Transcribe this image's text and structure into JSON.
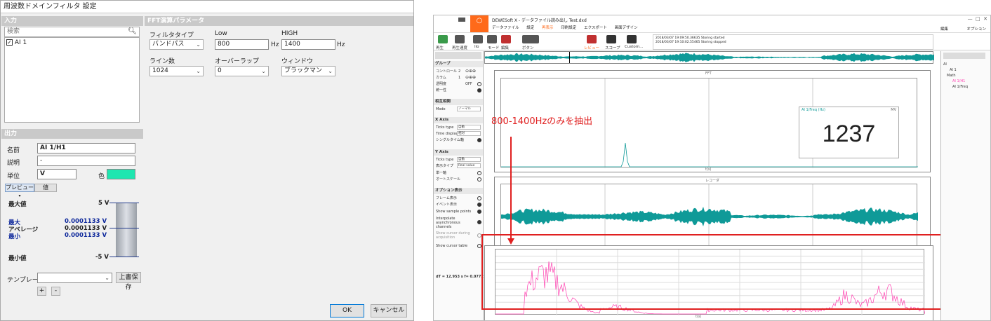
{
  "dialog": {
    "title": "周波数ドメインフィルタ 設定",
    "input_section": "入力",
    "search_placeholder": "検索",
    "channel": "AI 1",
    "fft_section": "FFT演算パラメータ",
    "filter_type_label": "フィルタタイプ",
    "filter_type": "バンドパス",
    "low_label": "Low",
    "low_value": "800",
    "low_unit": "Hz",
    "high_label": "HIGH",
    "high_value": "1400",
    "high_unit": "Hz",
    "lines_label": "ライン数",
    "lines": "1024",
    "overlap_label": "オーバーラップ",
    "overlap": "0",
    "window_label": "ウィンドウ",
    "window": "ブラックマン",
    "output_section": "出力",
    "name_label": "名前",
    "name_value": "AI 1/H1",
    "desc_label": "説明",
    "desc_value": "-",
    "unit_label": "単位",
    "unit_value": "V",
    "color_label": "色",
    "color_value": "#1fe6b0",
    "preview_tab": "プレビュー",
    "value_tab": "値",
    "max_label": "最大値",
    "max_scale": "5 V",
    "stat_max_label": "最大",
    "stat_max": "0.0001133 V",
    "stat_avg_label": "アベレージ",
    "stat_avg": "0.0001133 V",
    "stat_min_label": "最小",
    "stat_min": "0.0001133 V",
    "min_label": "最小値",
    "min_scale": "-5 V",
    "template_label": "テンプレート",
    "overwrite": "上書保存",
    "plus": "+",
    "minus": "-",
    "ok": "OK",
    "cancel": "キャンセル"
  },
  "app": {
    "title": "DEWESoft X - データファイル読み出し Test.dxd",
    "menu": [
      "データファイル",
      "設定",
      "再表示",
      "印刷設定",
      "エクスポート",
      "画面デザイン"
    ],
    "edit": "編集",
    "option": "オプション",
    "tools": [
      "再生",
      "再生速度",
      "Ilo",
      "モード",
      "編集",
      "ボタン",
      "レビュー",
      "スコープ",
      "Custom..."
    ],
    "log1": "2018/03/07 19:09:50.36635   Storing started",
    "log2": "2018/03/07 19:10:02.55465   Storing stopped",
    "panel": {
      "group": "グループ",
      "controls": "コントロール",
      "columns": "カラム",
      "cols_val": "2",
      "cols_val2": "1",
      "transparent": "透明度",
      "transparent_val": "OFF",
      "unify": "統一性",
      "display": "相互相関",
      "mode": "Mode",
      "mode_val": "ノーマル",
      "xaxis": "X Axis",
      "ticks_type": "Ticks type",
      "ticks_val": "自動",
      "time_display": "Time display",
      "time_val": "相対",
      "single_axis": "シングルタイム軸",
      "yaxis": "Y Axis",
      "yticks_type": "Ticks type",
      "yticks_val": "自動",
      "disp_type": "表示タイプ",
      "disp_val": "Real value",
      "one_axis": "単一軸",
      "autoscale": "オートスケール",
      "options": "オプション表示",
      "frame": "フレーム表示",
      "event": "イベント表示",
      "samples": "Show sample points",
      "interp": "Interpolate asynchronous channels",
      "cursor_acq": "Show cursor during acquisition",
      "cursor_table": "Show cursor table",
      "dt": "dT = 12.953 s  f= 0.0772 Hz"
    },
    "fft_title": "FFT",
    "recorder_title": "レコーダ",
    "display_value": "1237",
    "overlay_label": "AI 1/Freq (Hz)",
    "overlay_right": "MV",
    "axis_x": "t(s)",
    "annotation": "800-1400Hzのみを抽出",
    "tree": [
      "AI",
      "AI 1",
      "Math",
      "AI 1/H1",
      "AI 1/Freq"
    ]
  },
  "colors": {
    "accent": "#ff6a1a",
    "teal": "#0f9a98",
    "pink": "#ff3fb0",
    "red": "#e02020"
  }
}
